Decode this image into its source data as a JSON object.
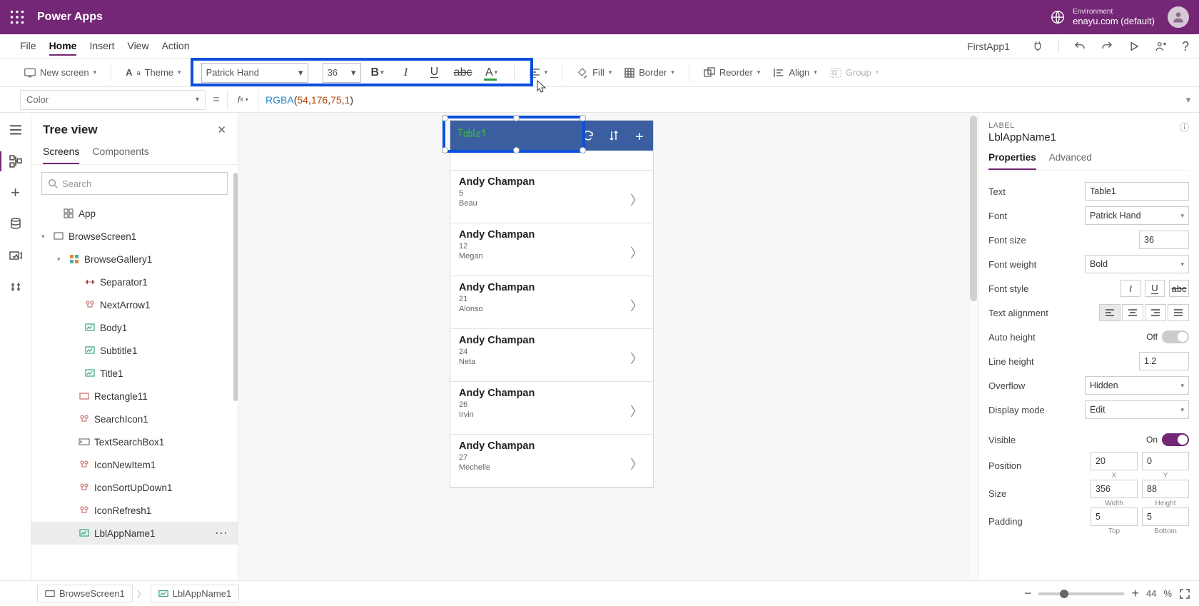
{
  "titlebar": {
    "app_name": "Power Apps",
    "env_label": "Environment",
    "env_value": "enayu.com (default)"
  },
  "menubar": {
    "items": [
      "File",
      "Home",
      "Insert",
      "View",
      "Action"
    ],
    "active_index": 1,
    "file_name": "FirstApp1"
  },
  "toolbar": {
    "new_screen": "New screen",
    "theme": "Theme",
    "font": "Patrick Hand",
    "font_size": "36",
    "fill": "Fill",
    "border": "Border",
    "reorder": "Reorder",
    "align": "Align",
    "group": "Group"
  },
  "fx": {
    "prop": "Color",
    "fn": "RGBA",
    "args": [
      "54",
      "176",
      "75",
      "1"
    ]
  },
  "tree": {
    "title": "Tree view",
    "tabs": [
      "Screens",
      "Components"
    ],
    "search_placeholder": "Search",
    "items": [
      {
        "label": "App",
        "indent": 0,
        "icon": "app"
      },
      {
        "label": "BrowseScreen1",
        "indent": 0,
        "icon": "screen",
        "exp": true
      },
      {
        "label": "BrowseGallery1",
        "indent": 1,
        "icon": "gallery",
        "exp": true
      },
      {
        "label": "Separator1",
        "indent": 2,
        "icon": "sep"
      },
      {
        "label": "NextArrow1",
        "indent": 2,
        "icon": "arr"
      },
      {
        "label": "Body1",
        "indent": 2,
        "icon": "lbl"
      },
      {
        "label": "Subtitle1",
        "indent": 2,
        "icon": "lbl"
      },
      {
        "label": "Title1",
        "indent": 2,
        "icon": "lbl"
      },
      {
        "label": "Rectangle11",
        "indent": 1,
        "icon": "rect"
      },
      {
        "label": "SearchIcon1",
        "indent": 1,
        "icon": "arr"
      },
      {
        "label": "TextSearchBox1",
        "indent": 1,
        "icon": "txt"
      },
      {
        "label": "IconNewItem1",
        "indent": 1,
        "icon": "arr"
      },
      {
        "label": "IconSortUpDown1",
        "indent": 1,
        "icon": "arr"
      },
      {
        "label": "IconRefresh1",
        "indent": 1,
        "icon": "arr"
      },
      {
        "label": "LblAppName1",
        "indent": 1,
        "icon": "lbl",
        "selected": true
      }
    ]
  },
  "canvas": {
    "appbar_title": "Table1",
    "rows": [
      {
        "name": "Andy Champan",
        "l1": "5",
        "l2": "Beau"
      },
      {
        "name": "Andy Champan",
        "l1": "12",
        "l2": "Megan"
      },
      {
        "name": "Andy Champan",
        "l1": "21",
        "l2": "Alonso"
      },
      {
        "name": "Andy Champan",
        "l1": "24",
        "l2": "Neta"
      },
      {
        "name": "Andy Champan",
        "l1": "26",
        "l2": "Irvin"
      },
      {
        "name": "Andy Champan",
        "l1": "27",
        "l2": "Mechelle"
      }
    ]
  },
  "props": {
    "section": "LABEL",
    "name": "LblAppName1",
    "tabs": [
      "Properties",
      "Advanced"
    ],
    "text_k": "Text",
    "text_v": "Table1",
    "font_k": "Font",
    "font_v": "Patrick Hand",
    "fsize_k": "Font size",
    "fsize_v": "36",
    "fweight_k": "Font weight",
    "fweight_v": "Bold",
    "fstyle_k": "Font style",
    "talign_k": "Text alignment",
    "auto_k": "Auto height",
    "auto_v": "Off",
    "lh_k": "Line height",
    "lh_v": "1.2",
    "ovf_k": "Overflow",
    "ovf_v": "Hidden",
    "disp_k": "Display mode",
    "disp_v": "Edit",
    "vis_k": "Visible",
    "vis_v": "On",
    "pos_k": "Position",
    "pos_x": "20",
    "pos_y": "0",
    "pos_xl": "X",
    "pos_yl": "Y",
    "size_k": "Size",
    "size_w": "356",
    "size_h": "88",
    "size_wl": "Width",
    "size_hl": "Height",
    "pad_k": "Padding",
    "pad_t": "5",
    "pad_b": "5",
    "pad_tl": "Top",
    "pad_bl": "Bottom"
  },
  "bottom": {
    "crumb1": "BrowseScreen1",
    "crumb2": "LblAppName1",
    "zoom": "44",
    "pct": "%"
  }
}
